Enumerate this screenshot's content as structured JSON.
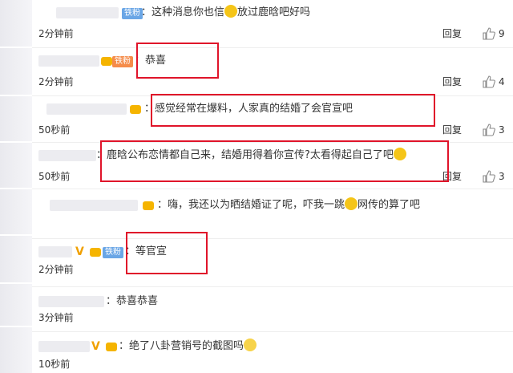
{
  "ui": {
    "reply_label": "回复"
  },
  "badges": {
    "iron_fan": "铁粉"
  },
  "comments": [
    {
      "text_a": "：这种消息你也信",
      "text_b": "放过鹿晗吧好吗",
      "time": "2分钟前",
      "likes": "9"
    },
    {
      "text_a": "：恭喜",
      "time": "2分钟前",
      "likes": "4"
    },
    {
      "text_a": "：感觉经常在爆料，人家真的结婚了会官宣吧",
      "time": "50秒前",
      "likes": "3"
    },
    {
      "text_a": "：鹿晗公布恋情都自己来，结婚用得着你宣传?太看得起自己了吧",
      "time": "50秒前",
      "likes": "3"
    },
    {
      "text_a": "：嗨，我还以为晒结婚证了呢，吓我一跳",
      "text_b": "网传的算了吧",
      "time": "",
      "likes": ""
    },
    {
      "text_a": "：等官宣",
      "time": "2分钟前",
      "likes": ""
    },
    {
      "text_a": "：恭喜恭喜",
      "time": "3分钟前",
      "likes": ""
    },
    {
      "text_a": "：绝了八卦营销号的截图吗",
      "time": "10秒前",
      "likes": ""
    }
  ],
  "colors": {
    "highlight_box": "#e0142a",
    "iron_fan_badge": "#6aa6e6"
  },
  "icons": [
    "like-icon",
    "emoji-icon",
    "vip-icon"
  ]
}
